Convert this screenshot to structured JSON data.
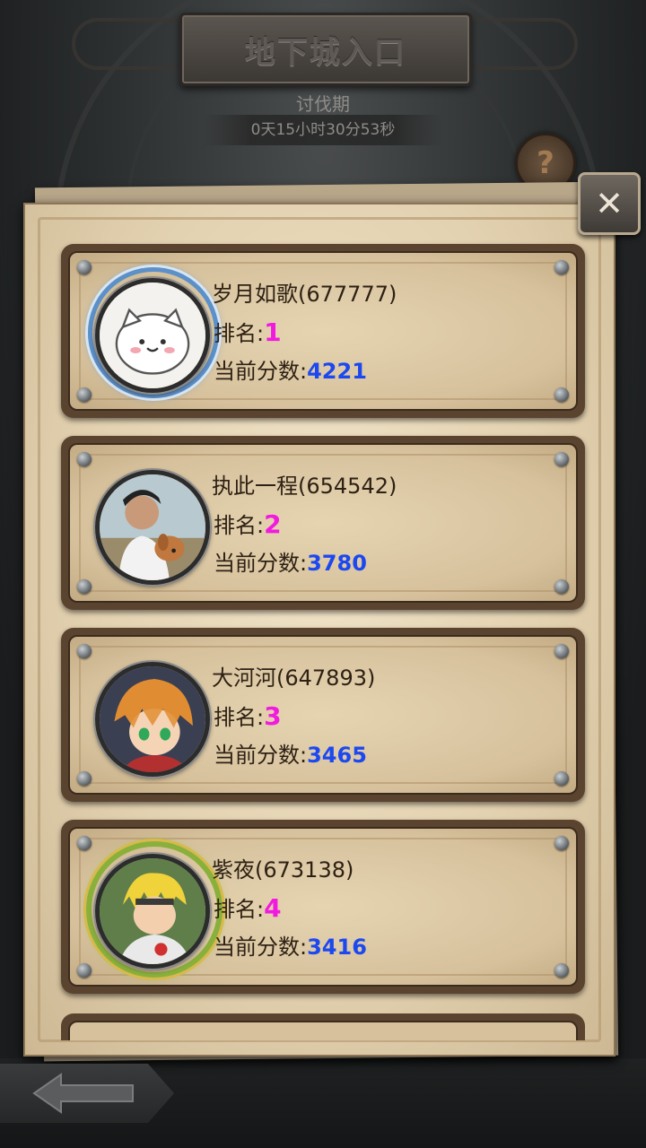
{
  "header": {
    "title": "地下城入口",
    "phase_label": "讨伐期",
    "countdown": "0天15小时30分53秒"
  },
  "labels": {
    "rank_label": "排名:",
    "score_label": "当前分数:"
  },
  "icons": {
    "help": "?",
    "close": "✕",
    "back": "back-arrow-icon"
  },
  "players": [
    {
      "name": "岁月如歌(677777)",
      "rank": "1",
      "score": "4221"
    },
    {
      "name": "执此一程(654542)",
      "rank": "2",
      "score": "3780"
    },
    {
      "name": "大河河(647893)",
      "rank": "3",
      "score": "3465"
    },
    {
      "name": "紫夜(673138)",
      "rank": "4",
      "score": "3416"
    }
  ],
  "colors": {
    "rank": "#f21ae0",
    "score": "#1c48ef",
    "parchment": "#e3d2b1"
  }
}
